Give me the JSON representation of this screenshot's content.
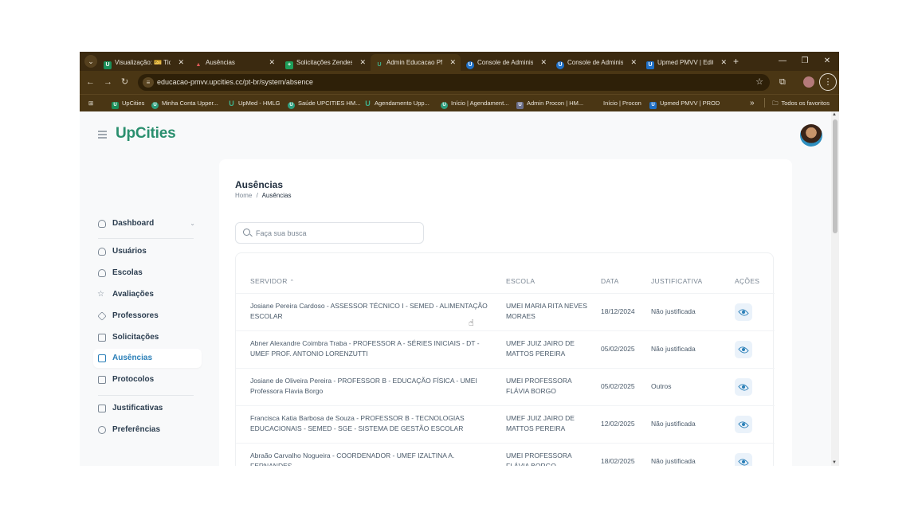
{
  "browser": {
    "tabs": [
      {
        "label": "Visualização: 🎫 Tick",
        "favicon": "zendesk-green",
        "active": false
      },
      {
        "label": "Ausências",
        "favicon": "red-triangle",
        "active": false
      },
      {
        "label": "Solicitações Zendesk",
        "favicon": "sheets",
        "active": false
      },
      {
        "label": "Admin Educacao PM",
        "favicon": "upcities",
        "active": true
      },
      {
        "label": "Console de Administ",
        "favicon": "upcities-blue",
        "active": false
      },
      {
        "label": "Console de Administ",
        "favicon": "upcities-blue",
        "active": false
      },
      {
        "label": "Upmed PMVV | Edita",
        "favicon": "upmed",
        "active": false
      }
    ],
    "url": "educacao-pmvv.upcities.cc/pt-br/system/absence",
    "bookmarks": [
      "UpCities",
      "Minha Conta Upper...",
      "UpMed - HMLG",
      "Saúde UPCITIES HM...",
      "Agendamento Upp...",
      "Início | Agendament...",
      "Admin Procon | HM...",
      "Início | Procon",
      "Upmed PMVV | PROD"
    ],
    "bookmarks_more": "»",
    "bookmarks_folder": "Todos os favoritos"
  },
  "app": {
    "logo": "UpCities",
    "sidebar": [
      {
        "label": "Dashboard",
        "icon": "home-icon",
        "active": false,
        "chevron": "⌄"
      },
      {
        "label": "Usuários",
        "icon": "user-icon",
        "active": false
      },
      {
        "label": "Escolas",
        "icon": "user-icon",
        "active": false
      },
      {
        "label": "Avaliações",
        "icon": "star-icon",
        "active": false
      },
      {
        "label": "Professores",
        "icon": "graduation-icon",
        "active": false
      },
      {
        "label": "Solicitações",
        "icon": "document-icon",
        "active": false
      },
      {
        "label": "Ausências",
        "icon": "calendar-icon",
        "active": true
      },
      {
        "label": "Protocolos",
        "icon": "document-icon",
        "active": false
      },
      {
        "label": "Justificativas",
        "icon": "document-icon",
        "active": false
      },
      {
        "label": "Preferências",
        "icon": "gear-icon",
        "active": false
      }
    ]
  },
  "main": {
    "title": "Ausências",
    "breadcrumb": {
      "home": "Home",
      "sep": "/",
      "current": "Ausências"
    },
    "search_placeholder": "Faça sua busca",
    "columns": {
      "servidor": "SERVIDOR",
      "sort": "⌃",
      "escola": "ESCOLA",
      "data": "DATA",
      "justificativa": "JUSTIFICATIVA",
      "acoes": "AÇÕES"
    },
    "rows": [
      {
        "servidor": "Josiane Pereira Cardoso - ASSESSOR TÉCNICO I - SEMED - ALIMENTAÇÃO ESCOLAR",
        "escola": "UMEI MARIA RITA NEVES MORAES",
        "data": "18/12/2024",
        "justificativa": "Não justificada"
      },
      {
        "servidor": "Abner Alexandre Coimbra Traba - PROFESSOR A - SÉRIES INICIAIS - DT - UMEF PROF. ANTONIO LORENZUTTI",
        "escola": "UMEF JUIZ JAIRO DE MATTOS PEREIRA",
        "data": "05/02/2025",
        "justificativa": "Não justificada"
      },
      {
        "servidor": "Josiane de Oliveira Pereira - PROFESSOR B - EDUCAÇÃO FÍSICA - UMEI Professora Flavia Borgo",
        "escola": "UMEI PROFESSORA FLÁVIA BORGO",
        "data": "05/02/2025",
        "justificativa": "Outros"
      },
      {
        "servidor": "Francisca Katia Barbosa de Souza - PROFESSOR B - TECNOLOGIAS EDUCACIONAIS - SEMED - SGE - SISTEMA DE GESTÃO ESCOLAR",
        "escola": "UMEF JUIZ JAIRO DE MATTOS PEREIRA",
        "data": "12/02/2025",
        "justificativa": "Não justificada"
      },
      {
        "servidor": "Abraão Carvalho Nogueira - COORDENADOR - UMEF IZALTINA A. FERNANDES",
        "escola": "UMEI PROFESSORA FLÁVIA BORGO",
        "data": "18/02/2025",
        "justificativa": "Não justificada"
      }
    ]
  }
}
